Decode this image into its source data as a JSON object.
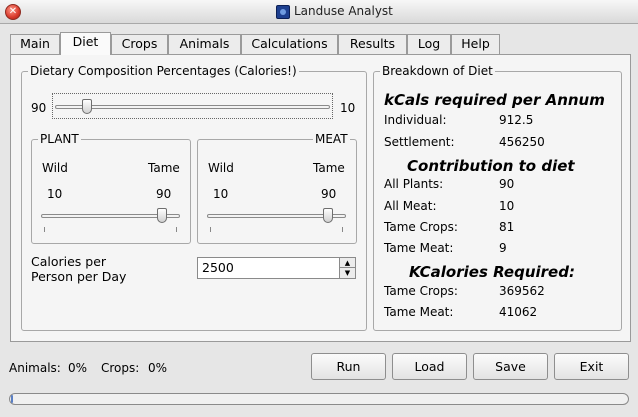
{
  "window": {
    "title": "Landuse Analyst",
    "close_symbol": "✕"
  },
  "tabs": [
    {
      "label": "Main"
    },
    {
      "label": "Diet"
    },
    {
      "label": "Crops"
    },
    {
      "label": "Animals"
    },
    {
      "label": "Calculations"
    },
    {
      "label": "Results"
    },
    {
      "label": "Log"
    },
    {
      "label": "Help"
    }
  ],
  "active_tab": "Diet",
  "diet": {
    "group_title": "Dietary Composition Percentages (Calories!)",
    "plant_meat_slider": {
      "left_value": "90",
      "right_value": "10",
      "level": 0.1
    },
    "plant": {
      "title": "PLANT",
      "wild_label": "Wild",
      "tame_label": "Tame",
      "wild_value": "10",
      "tame_value": "90",
      "level": 0.9
    },
    "meat": {
      "title": "MEAT",
      "wild_label": "Wild",
      "tame_label": "Tame",
      "wild_value": "10",
      "tame_value": "90",
      "level": 0.9
    },
    "calories_label_line1": "Calories per",
    "calories_label_line2": "Person per Day",
    "calories_value": "2500"
  },
  "breakdown": {
    "group_title": "Breakdown of Diet",
    "kcals_heading": "kCals required per Annum",
    "individual_label": "Individual:",
    "individual_value": "912.5",
    "settlement_label": "Settlement:",
    "settlement_value": "456250",
    "contribution_heading": "Contribution to diet",
    "all_plants_label": "All Plants:",
    "all_plants_value": "90",
    "all_meat_label": "All Meat:",
    "all_meat_value": "10",
    "tame_crops_label": "Tame Crops:",
    "tame_crops_value": "81",
    "tame_meat_label": "Tame Meat:",
    "tame_meat_value": "9",
    "kcalories_heading": "KCalories Required:",
    "kc_tame_crops_label": "Tame Crops:",
    "kc_tame_crops_value": "369562",
    "kc_tame_meat_label": "Tame Meat:",
    "kc_tame_meat_value": "41062"
  },
  "status": {
    "animals_label": "Animals:",
    "animals_value": "0%",
    "crops_label": "Crops:",
    "crops_value": "0%"
  },
  "buttons": {
    "run": "Run",
    "load": "Load",
    "save": "Save",
    "exit": "Exit"
  },
  "progress": {
    "level": 0.0
  }
}
